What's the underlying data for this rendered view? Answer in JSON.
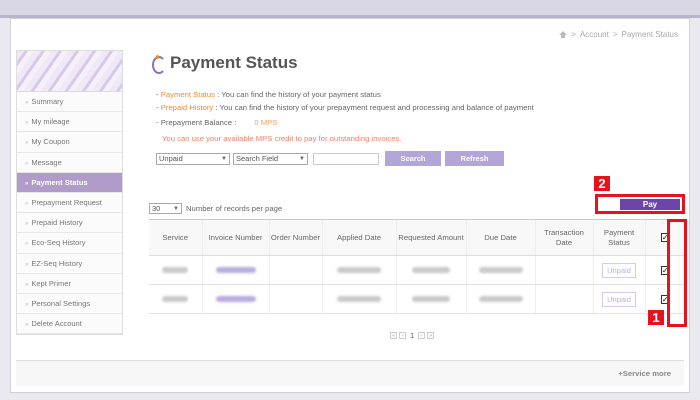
{
  "breadcrumb": [
    "Account",
    "Payment Status"
  ],
  "sidebar": {
    "items": [
      {
        "label": "Summary"
      },
      {
        "label": "My mileage"
      },
      {
        "label": "My Coupon"
      },
      {
        "label": "Message"
      },
      {
        "label": "Payment Status"
      },
      {
        "label": "Prepayment Request"
      },
      {
        "label": "Prepaid History"
      },
      {
        "label": "Eco-Seq History"
      },
      {
        "label": "EZ-Seq History"
      },
      {
        "label": "Kept Primer"
      },
      {
        "label": "Personal Settings"
      },
      {
        "label": "Delete Account"
      }
    ]
  },
  "page_title": "Payment Status",
  "info": {
    "line1_label": "Payment Status",
    "line1_text": " : You can find the history of your payment status",
    "line2_label": "Prepaid History",
    "line2_text": " : You can find the history of your prepayment request and processing and balance of payment"
  },
  "balance": {
    "label": "- Prepayment Balance :",
    "value": "0 MPS"
  },
  "credit_notice": "You can use your available MPS credit to pay for outstanding invoices.",
  "filters": {
    "status_value": "Unpaid",
    "field_value": "Search Field",
    "search_label": "Search",
    "refresh_label": "Refresh"
  },
  "records": {
    "value": "30",
    "label": "Number of records per page"
  },
  "pay_label": "Pay",
  "badges": {
    "one": "1",
    "two": "2"
  },
  "table": {
    "headers": [
      "Service",
      "Invoice Number",
      "Order Number",
      "Applied Date",
      "Requested Amount",
      "Due Date",
      "Transaction Date",
      "Payment Status",
      ""
    ],
    "rows": [
      {
        "status": "Unpaid",
        "checked": "✓"
      },
      {
        "status": "Unpaid",
        "checked": "✓"
      }
    ],
    "header_checked": "✓"
  },
  "pagination": {
    "first": "«",
    "prev": "‹",
    "page": "1",
    "next": "›",
    "last": "»"
  },
  "footer": {
    "service_more": "+Service more"
  }
}
